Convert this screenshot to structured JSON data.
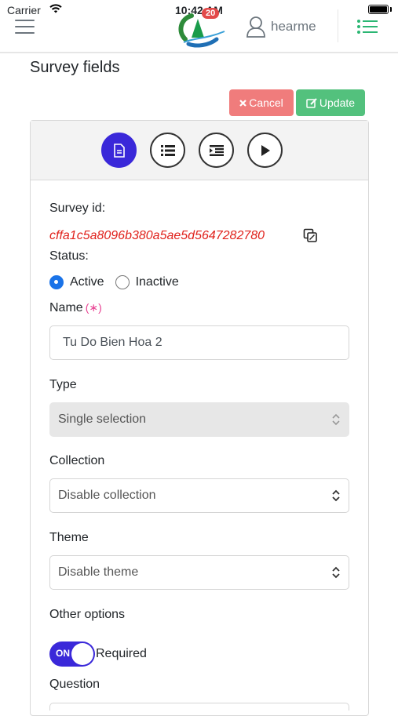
{
  "status_bar": {
    "carrier": "Carrier",
    "time": "10:42 AM"
  },
  "header": {
    "badge_count": "20",
    "username": "hearme"
  },
  "page": {
    "title": "Survey fields"
  },
  "actions": {
    "cancel_label": "Cancel",
    "update_label": "Update"
  },
  "steps": [
    {
      "icon": "document-icon",
      "active": true
    },
    {
      "icon": "list-icon",
      "active": false
    },
    {
      "icon": "indent-icon",
      "active": false
    },
    {
      "icon": "play-icon",
      "active": false
    }
  ],
  "form": {
    "survey_id_label": "Survey id:",
    "survey_id_value": "cffa1c5a8096b380a5ae5d5647282780",
    "status_label": "Status:",
    "status_options": [
      "Active",
      "Inactive"
    ],
    "status_selected": "Active",
    "name_label": "Name",
    "required_marker": "(∗)",
    "name_value": "Tu Do Bien Hoa 2",
    "type_label": "Type",
    "type_value": "Single selection",
    "collection_label": "Collection",
    "collection_value": "Disable collection",
    "theme_label": "Theme",
    "theme_value": "Disable theme",
    "other_options_label": "Other options",
    "toggle_state": "ON",
    "toggle_label": "Required",
    "question_label": "Question"
  },
  "colors": {
    "primary": "#3a28d9",
    "danger": "#f07c7c",
    "success": "#53c17d",
    "id_text": "#e0211b"
  }
}
